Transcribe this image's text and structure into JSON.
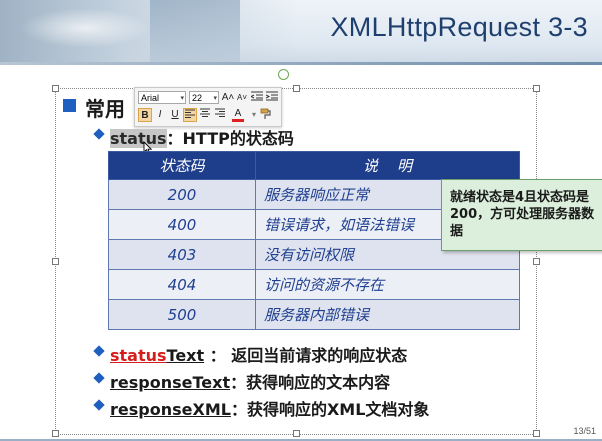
{
  "slide": {
    "title": "XMLHttpRequest 3-3",
    "heading": "常用",
    "page": "13/51"
  },
  "minibar": {
    "font": "Arial",
    "size": "22",
    "grow": "A˄",
    "shrink": "A˅",
    "bold": "B",
    "italic": "I",
    "underline": "U",
    "font_color": "A"
  },
  "bullets": [
    {
      "a": "status",
      "b": "：HTTP的状态码"
    },
    {
      "a": "status",
      "b": "Text",
      "c": " ： 返回当前请求的响应状态"
    },
    {
      "a": "responseText",
      "b": "：获得响应的文本内容"
    },
    {
      "a": "responseXML",
      "b": "：获得响应的XML文档对象"
    }
  ],
  "table": {
    "headers": [
      "状态码",
      "说    明"
    ],
    "rows": [
      {
        "code": "200",
        "desc": "服务器响应正常"
      },
      {
        "code": "400",
        "desc": "错误请求，如语法错误"
      },
      {
        "code": "403",
        "desc": "没有访问权限"
      },
      {
        "code": "404",
        "desc": "访问的资源不存在"
      },
      {
        "code": "500",
        "desc": "服务器内部错误"
      }
    ]
  },
  "callout": "就绪状态是4且状态码是200，方可处理服务器数据",
  "colors": {
    "accent": "#1f5fbf",
    "table_header": "#1e3d8a",
    "highlight_red": "#d41e1e",
    "callout_bg": "#dcefdc"
  }
}
